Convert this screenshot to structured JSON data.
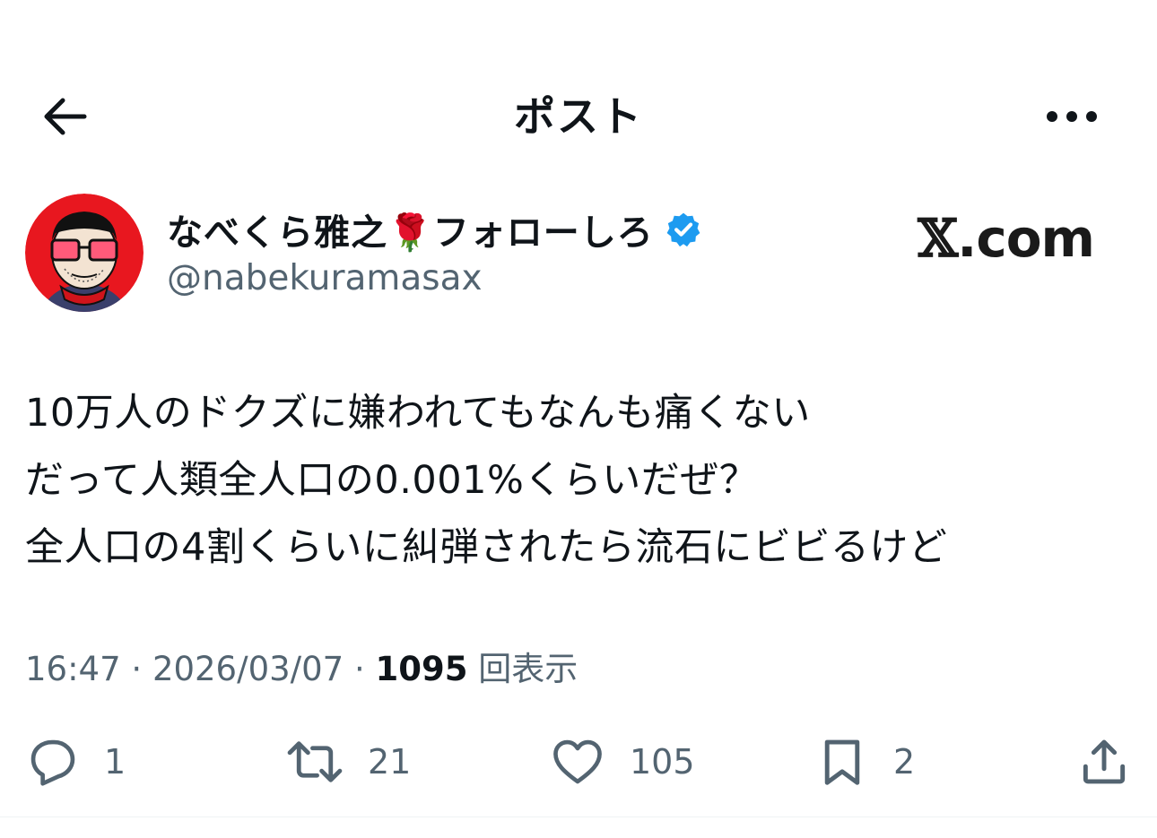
{
  "header": {
    "title": "ポスト",
    "back_icon": "arrow-left-icon",
    "more_icon": "ellipsis-icon"
  },
  "author": {
    "display_name": "なべくら雅之🌹フォローしろ",
    "handle": "@nabekuramasax",
    "verified": true,
    "verified_color": "#1d9bf0",
    "avatar_bg": "#e8171f"
  },
  "site_mark": {
    "x": "𝕏",
    "rest": ".com"
  },
  "tweet": {
    "lines": [
      "10万人のドクズに嫌われてもなんも痛くない",
      "だって人類全人口の0.001%くらいだぜ？",
      "全人口の4割くらいに糾弾されたら流石にビビるけど"
    ]
  },
  "meta": {
    "time": "16:47",
    "separator": " · ",
    "date": "2026/03/07",
    "views_count": "1095",
    "views_label": "回表示"
  },
  "actions": {
    "reply_count": "1",
    "retweet_count": "21",
    "like_count": "105",
    "bookmark_count": "2"
  },
  "colors": {
    "text": "#0f1419",
    "secondary": "#536471",
    "divider": "#eff3f4"
  }
}
